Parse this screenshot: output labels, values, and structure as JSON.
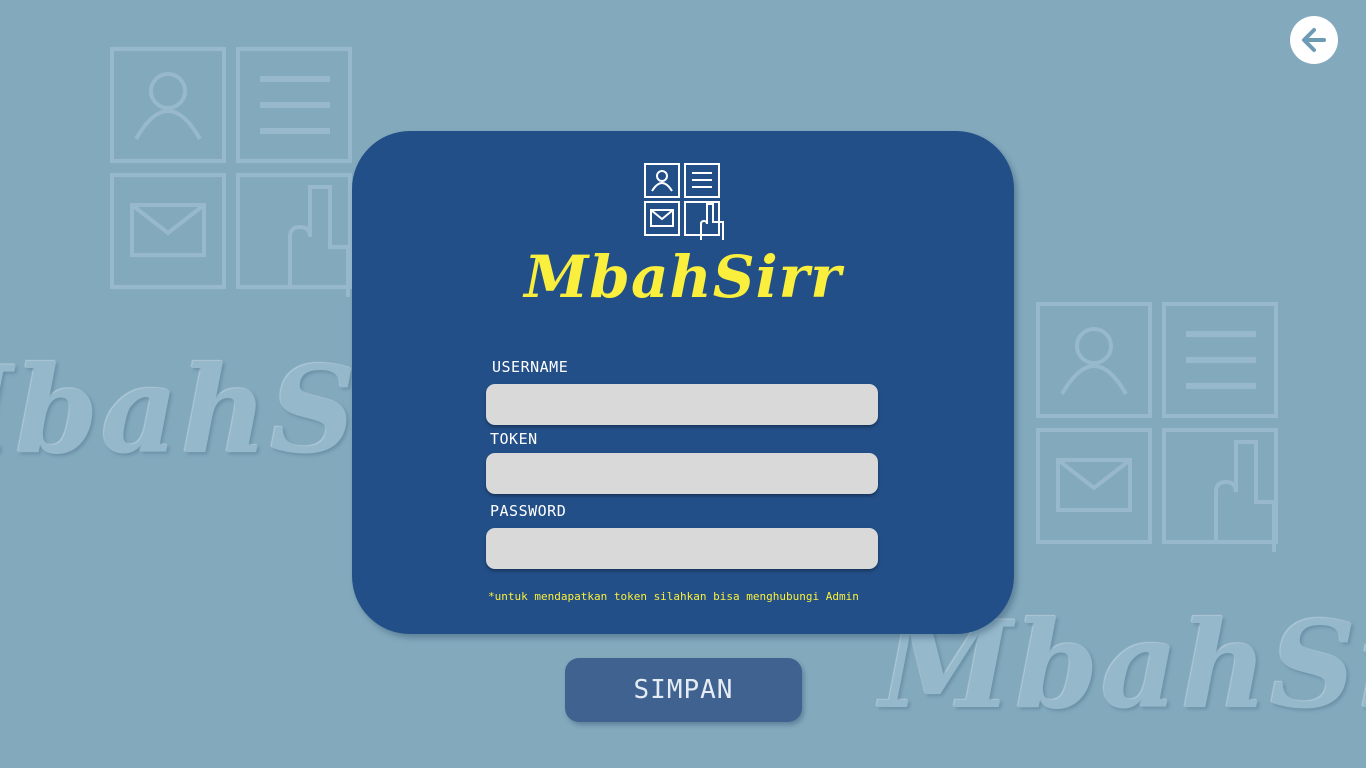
{
  "app": {
    "brand": "MbahSirr",
    "background_watermark": "MbahSirr"
  },
  "nav": {
    "back_icon": "arrow-left-icon"
  },
  "form": {
    "username": {
      "label": "USERNAME",
      "value": "",
      "placeholder": ""
    },
    "token": {
      "label": "TOKEN",
      "value": "",
      "placeholder": ""
    },
    "password": {
      "label": "PASSWORD",
      "value": "",
      "placeholder": ""
    },
    "note": "*untuk mendapatkan token silahkan bisa menghubungi Admin",
    "submit_label": "SIMPAN"
  },
  "colors": {
    "background": "#83a9bd",
    "card": "#234f88",
    "accent_yellow": "#f9ef3c",
    "input_bg": "#d9d9d9",
    "button": "#3f6290"
  }
}
